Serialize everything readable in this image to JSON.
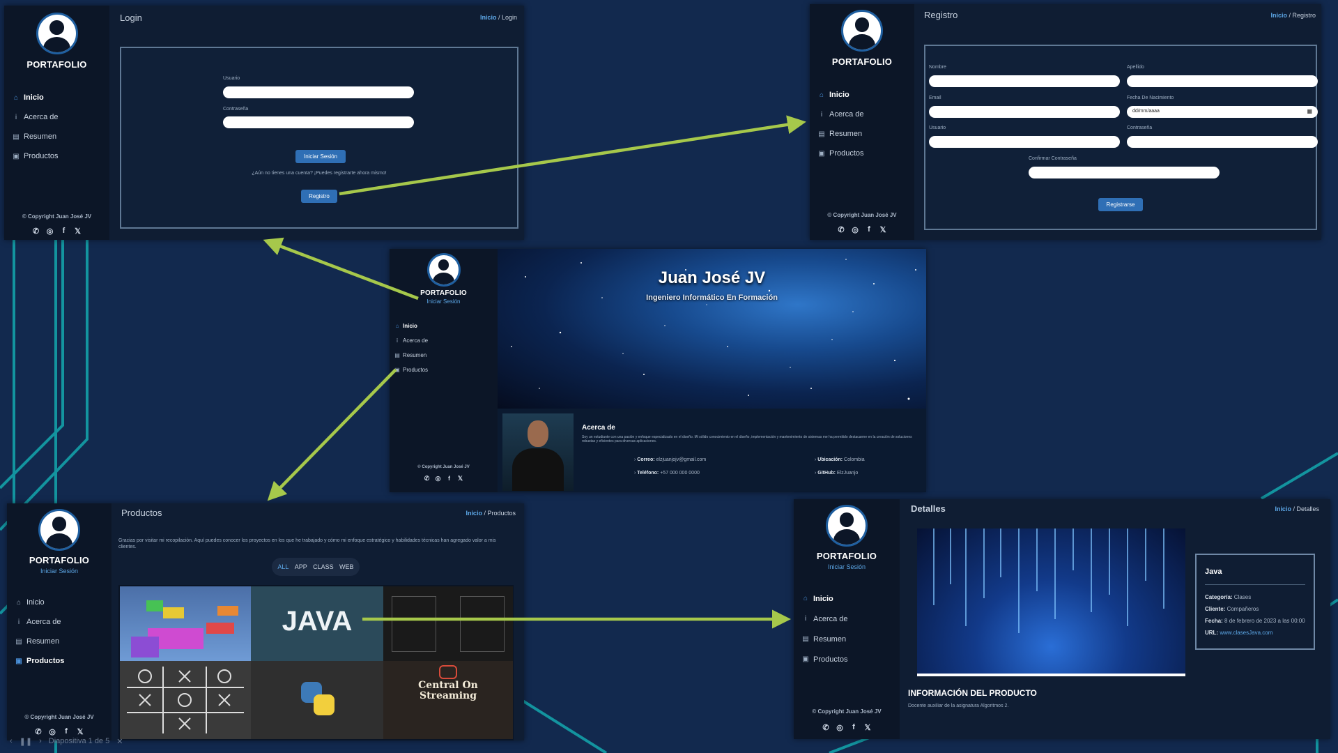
{
  "brand": "PORTAFOLIO",
  "login_link": "Iniciar Sesión",
  "copyright": "© Copyright Juan José JV",
  "nav": [
    "Inicio",
    "Acerca de",
    "Resumen",
    "Productos"
  ],
  "socials": [
    "whatsapp-icon",
    "instagram-icon",
    "facebook-icon",
    "x-icon"
  ],
  "crumb_home": "Inicio",
  "login": {
    "title": "Login",
    "crumb": "/ Login",
    "user_label": "Usuario",
    "pass_label": "Contraseña",
    "submit": "Iniciar Sesión",
    "hint": "¿Aún no tienes una cuenta? ¡Puedes registrarte ahora mismo!",
    "register": "Registro"
  },
  "registro": {
    "title": "Registro",
    "crumb": "/ Registro",
    "nombre": "Nombre",
    "apellido": "Apellido",
    "email": "Email",
    "fecha": "Fecha De Nacimiento",
    "fecha_value": "dd/mm/aaaa",
    "usuario": "Usuario",
    "contrasena": "Contraseña",
    "confirmar": "Confirmar Contraseña",
    "submit": "Registrarse"
  },
  "home": {
    "name": "Juan José JV",
    "subtitle": "Ingeniero Informático En Formación",
    "about_title": "Acerca de",
    "about_text": "Soy un estudiante con una pasión y enfoque especializado en el diseño. Mi sólido conocimiento en el diseño, implementación y mantenimiento de sistemas me ha permitido destacarme en la creación de soluciones robustas y eficientes para diversas aplicaciones.",
    "correo_label": "Correo:",
    "correo": "elzjuanjojv@gmail.com",
    "telefono_label": "Teléfono:",
    "telefono": "+57 000 000 0000",
    "ubicacion_label": "Ubicación:",
    "ubicacion": "Colombia",
    "github_label": "GitHub:",
    "github": "ElzJuanjo"
  },
  "productos": {
    "title": "Productos",
    "crumb": "/ Productos",
    "intro": "Gracias por visitar mi recopilación. Aquí puedes conocer los proyectos en los que he trabajado y cómo mi enfoque estratégico y habilidades técnicas han agregado valor a mis clientes.",
    "filters": [
      "ALL",
      "APP",
      "CLASS",
      "WEB"
    ],
    "java_text": "JAVA",
    "streaming_text": "Central On Streaming"
  },
  "detalles": {
    "title": "Detalles",
    "crumb": "/ Detalles",
    "card_title": "Java",
    "categoria_label": "Categoría:",
    "categoria": "Clases",
    "cliente_label": "Cliente:",
    "cliente": "Compañeros",
    "fecha_label": "Fecha:",
    "fecha": "8 de febrero de 2023 a las 00:00",
    "url_label": "URL:",
    "url": "www.clasesJava.com",
    "info_title": "INFORMACIÓN DEL PRODUCTO",
    "info_text": "Docente auxiliar de la asignatura Algoritmos 2."
  },
  "slide_counter": "Diapositiva 1 de 5",
  "colors": {
    "background": "#12294e",
    "panel": "#0f1d33",
    "sidebar": "#0c1627",
    "accent": "#2f6fb5",
    "link": "#5da8e8",
    "arrow": "#a6c84b",
    "circuit": "#14a0a8"
  }
}
